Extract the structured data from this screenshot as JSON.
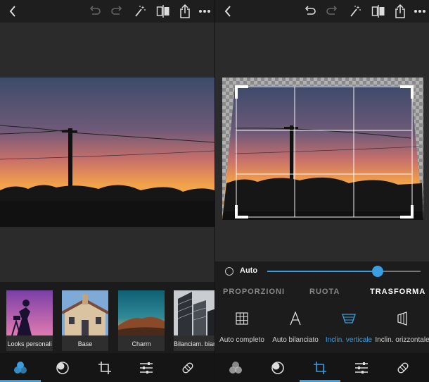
{
  "left": {
    "toolbar": {
      "back_icon": "chevron-left-icon",
      "undo_icon": "undo-icon",
      "redo_icon": "redo-icon",
      "magic_icon": "magic-wand-icon",
      "compare_icon": "compare-icon",
      "share_icon": "share-icon",
      "more_icon": "more-icon"
    },
    "filters": [
      {
        "label": "Looks personali"
      },
      {
        "label": "Base"
      },
      {
        "label": "Charm"
      },
      {
        "label": "Bilanciam. bianco"
      }
    ],
    "nav": [
      {
        "icon": "looks-icon",
        "active": true
      },
      {
        "icon": "adjust-icon",
        "active": false
      },
      {
        "icon": "crop-icon",
        "active": false
      },
      {
        "icon": "sliders-icon",
        "active": false
      },
      {
        "icon": "healing-icon",
        "active": false
      }
    ]
  },
  "right": {
    "auto": {
      "label": "Auto",
      "slider_value": 0.72
    },
    "tabs": [
      {
        "label": "PROPORZIONI",
        "active": false
      },
      {
        "label": "RUOTA",
        "active": false
      },
      {
        "label": "TRASFORMA",
        "active": true
      }
    ],
    "tools": [
      {
        "label": "Auto completo",
        "icon": "grid-icon",
        "active": false
      },
      {
        "label": "Auto bilanciato",
        "icon": "letter-a-icon",
        "active": false
      },
      {
        "label": "Inclin. verticale",
        "icon": "vertical-tilt-icon",
        "active": true
      },
      {
        "label": "Inclin. orizzontale",
        "icon": "horizontal-tilt-icon",
        "active": false
      }
    ],
    "nav": [
      {
        "icon": "looks-icon",
        "active": false
      },
      {
        "icon": "adjust-icon",
        "active": false
      },
      {
        "icon": "crop-icon",
        "active": true
      },
      {
        "icon": "sliders-icon",
        "active": false
      },
      {
        "icon": "healing-icon",
        "active": false
      }
    ]
  },
  "colors": {
    "accent": "#3a9fe0",
    "background": "#2b2b2b",
    "toolbar": "#1e1e1e"
  }
}
